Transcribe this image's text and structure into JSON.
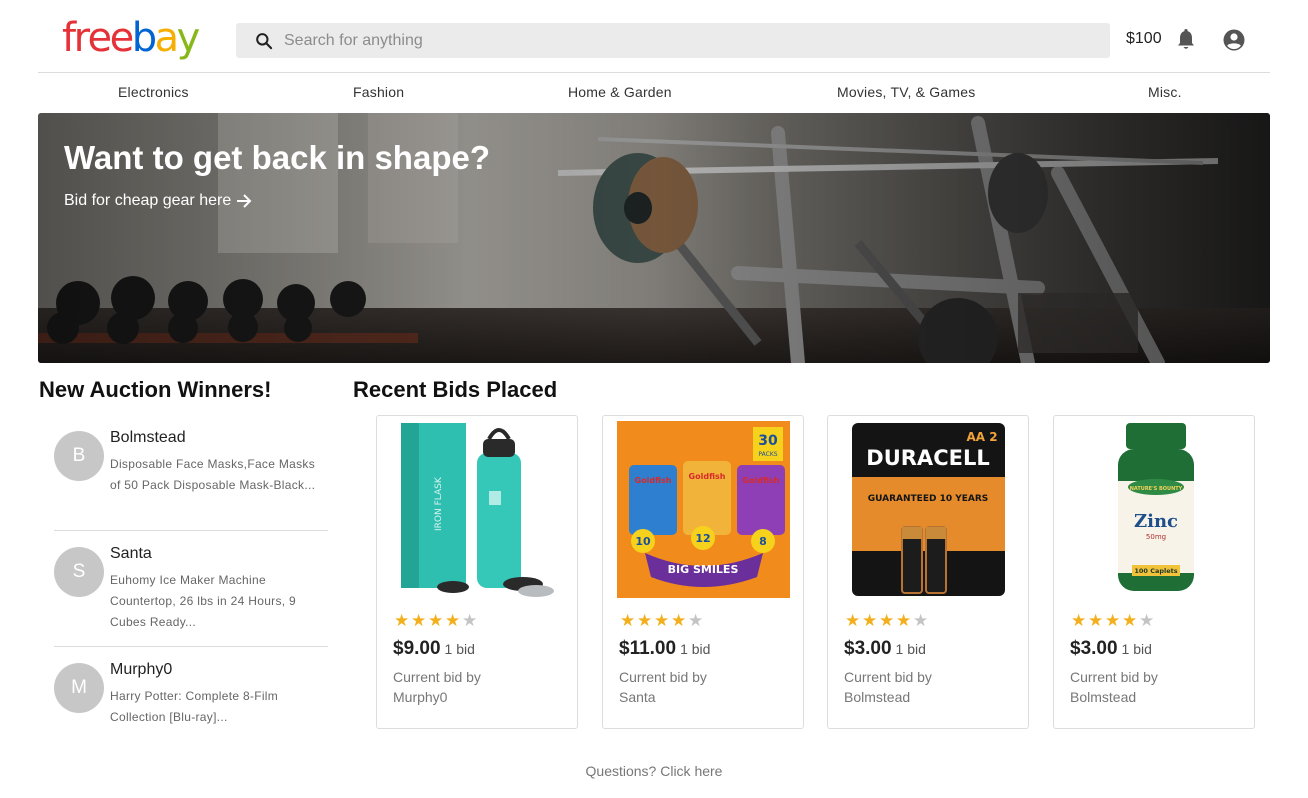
{
  "brand": {
    "logo_letters": [
      {
        "ch": "f",
        "color": "#e53238"
      },
      {
        "ch": "r",
        "color": "#e53238"
      },
      {
        "ch": "e",
        "color": "#e53238"
      },
      {
        "ch": "e",
        "color": "#e53238"
      },
      {
        "ch": "b",
        "color": "#0064d2"
      },
      {
        "ch": "a",
        "color": "#f5af02"
      },
      {
        "ch": "y",
        "color": "#86b817"
      }
    ]
  },
  "header": {
    "search_placeholder": "Search for anything",
    "balance": "$100",
    "icons": [
      "search-icon",
      "bell-icon",
      "account-icon"
    ]
  },
  "categories": [
    "Electronics",
    "Fashion",
    "Home & Garden",
    "Movies, TV, & Games",
    "Misc."
  ],
  "hero": {
    "title": "Want to get back in shape?",
    "link_text": "Bid for cheap gear here"
  },
  "winners": {
    "title": "New Auction Winners!",
    "items": [
      {
        "initial": "B",
        "name": "Bolmstead",
        "desc": "Disposable Face Masks,Face Masks of 50 Pack Disposable Mask-Black..."
      },
      {
        "initial": "S",
        "name": "Santa",
        "desc": "Euhomy Ice Maker Machine Countertop, 26 lbs in 24 Hours, 9 Cubes Ready..."
      },
      {
        "initial": "M",
        "name": "Murphy0",
        "desc": "Harry Potter: Complete 8-Film Collection [Blu-ray]..."
      }
    ]
  },
  "recent": {
    "title": "Recent Bids Placed",
    "items": [
      {
        "product": "water bottle",
        "rating": 4,
        "price": "$9.00",
        "bids": "1 bid",
        "bid_by_label": "Current bid by",
        "bidder": "Murphy0"
      },
      {
        "product": "goldfish crackers",
        "rating": 4,
        "price": "$11.00",
        "bids": "1 bid",
        "bid_by_label": "Current bid by",
        "bidder": "Santa"
      },
      {
        "product": "duracell batteries",
        "rating": 4,
        "price": "$3.00",
        "bids": "1 bid",
        "bid_by_label": "Current bid by",
        "bidder": "Bolmstead"
      },
      {
        "product": "zinc supplement",
        "rating": 4,
        "price": "$3.00",
        "bids": "1 bid",
        "bid_by_label": "Current bid by",
        "bidder": "Bolmstead"
      }
    ]
  },
  "product_art": {
    "flask_brand": "IRON FLASK",
    "goldfish_pack_count": "30",
    "goldfish_pack_label": "PACKS",
    "goldfish_flavors": [
      "Goldfish",
      "Goldfish",
      "Goldfish"
    ],
    "goldfish_counts": [
      "10",
      "12",
      "8"
    ],
    "goldfish_banner": "BIG SMILES",
    "duracell_size": "AA 2",
    "duracell_brand": "DURACELL",
    "duracell_claim": "GUARANTEED 10 YEARS",
    "zinc_brand": "NATURE'S BOUNTY",
    "zinc_name": "Zinc",
    "zinc_dose": "50mg",
    "zinc_count": "100 Caplets"
  },
  "footer": {
    "questions": "Questions? Click here"
  },
  "colors": {
    "star_filled": "#f2b01e",
    "star_empty": "#c4c4c4",
    "avatar_bg": "#c7c7c7",
    "search_bg": "#ebebeb"
  }
}
